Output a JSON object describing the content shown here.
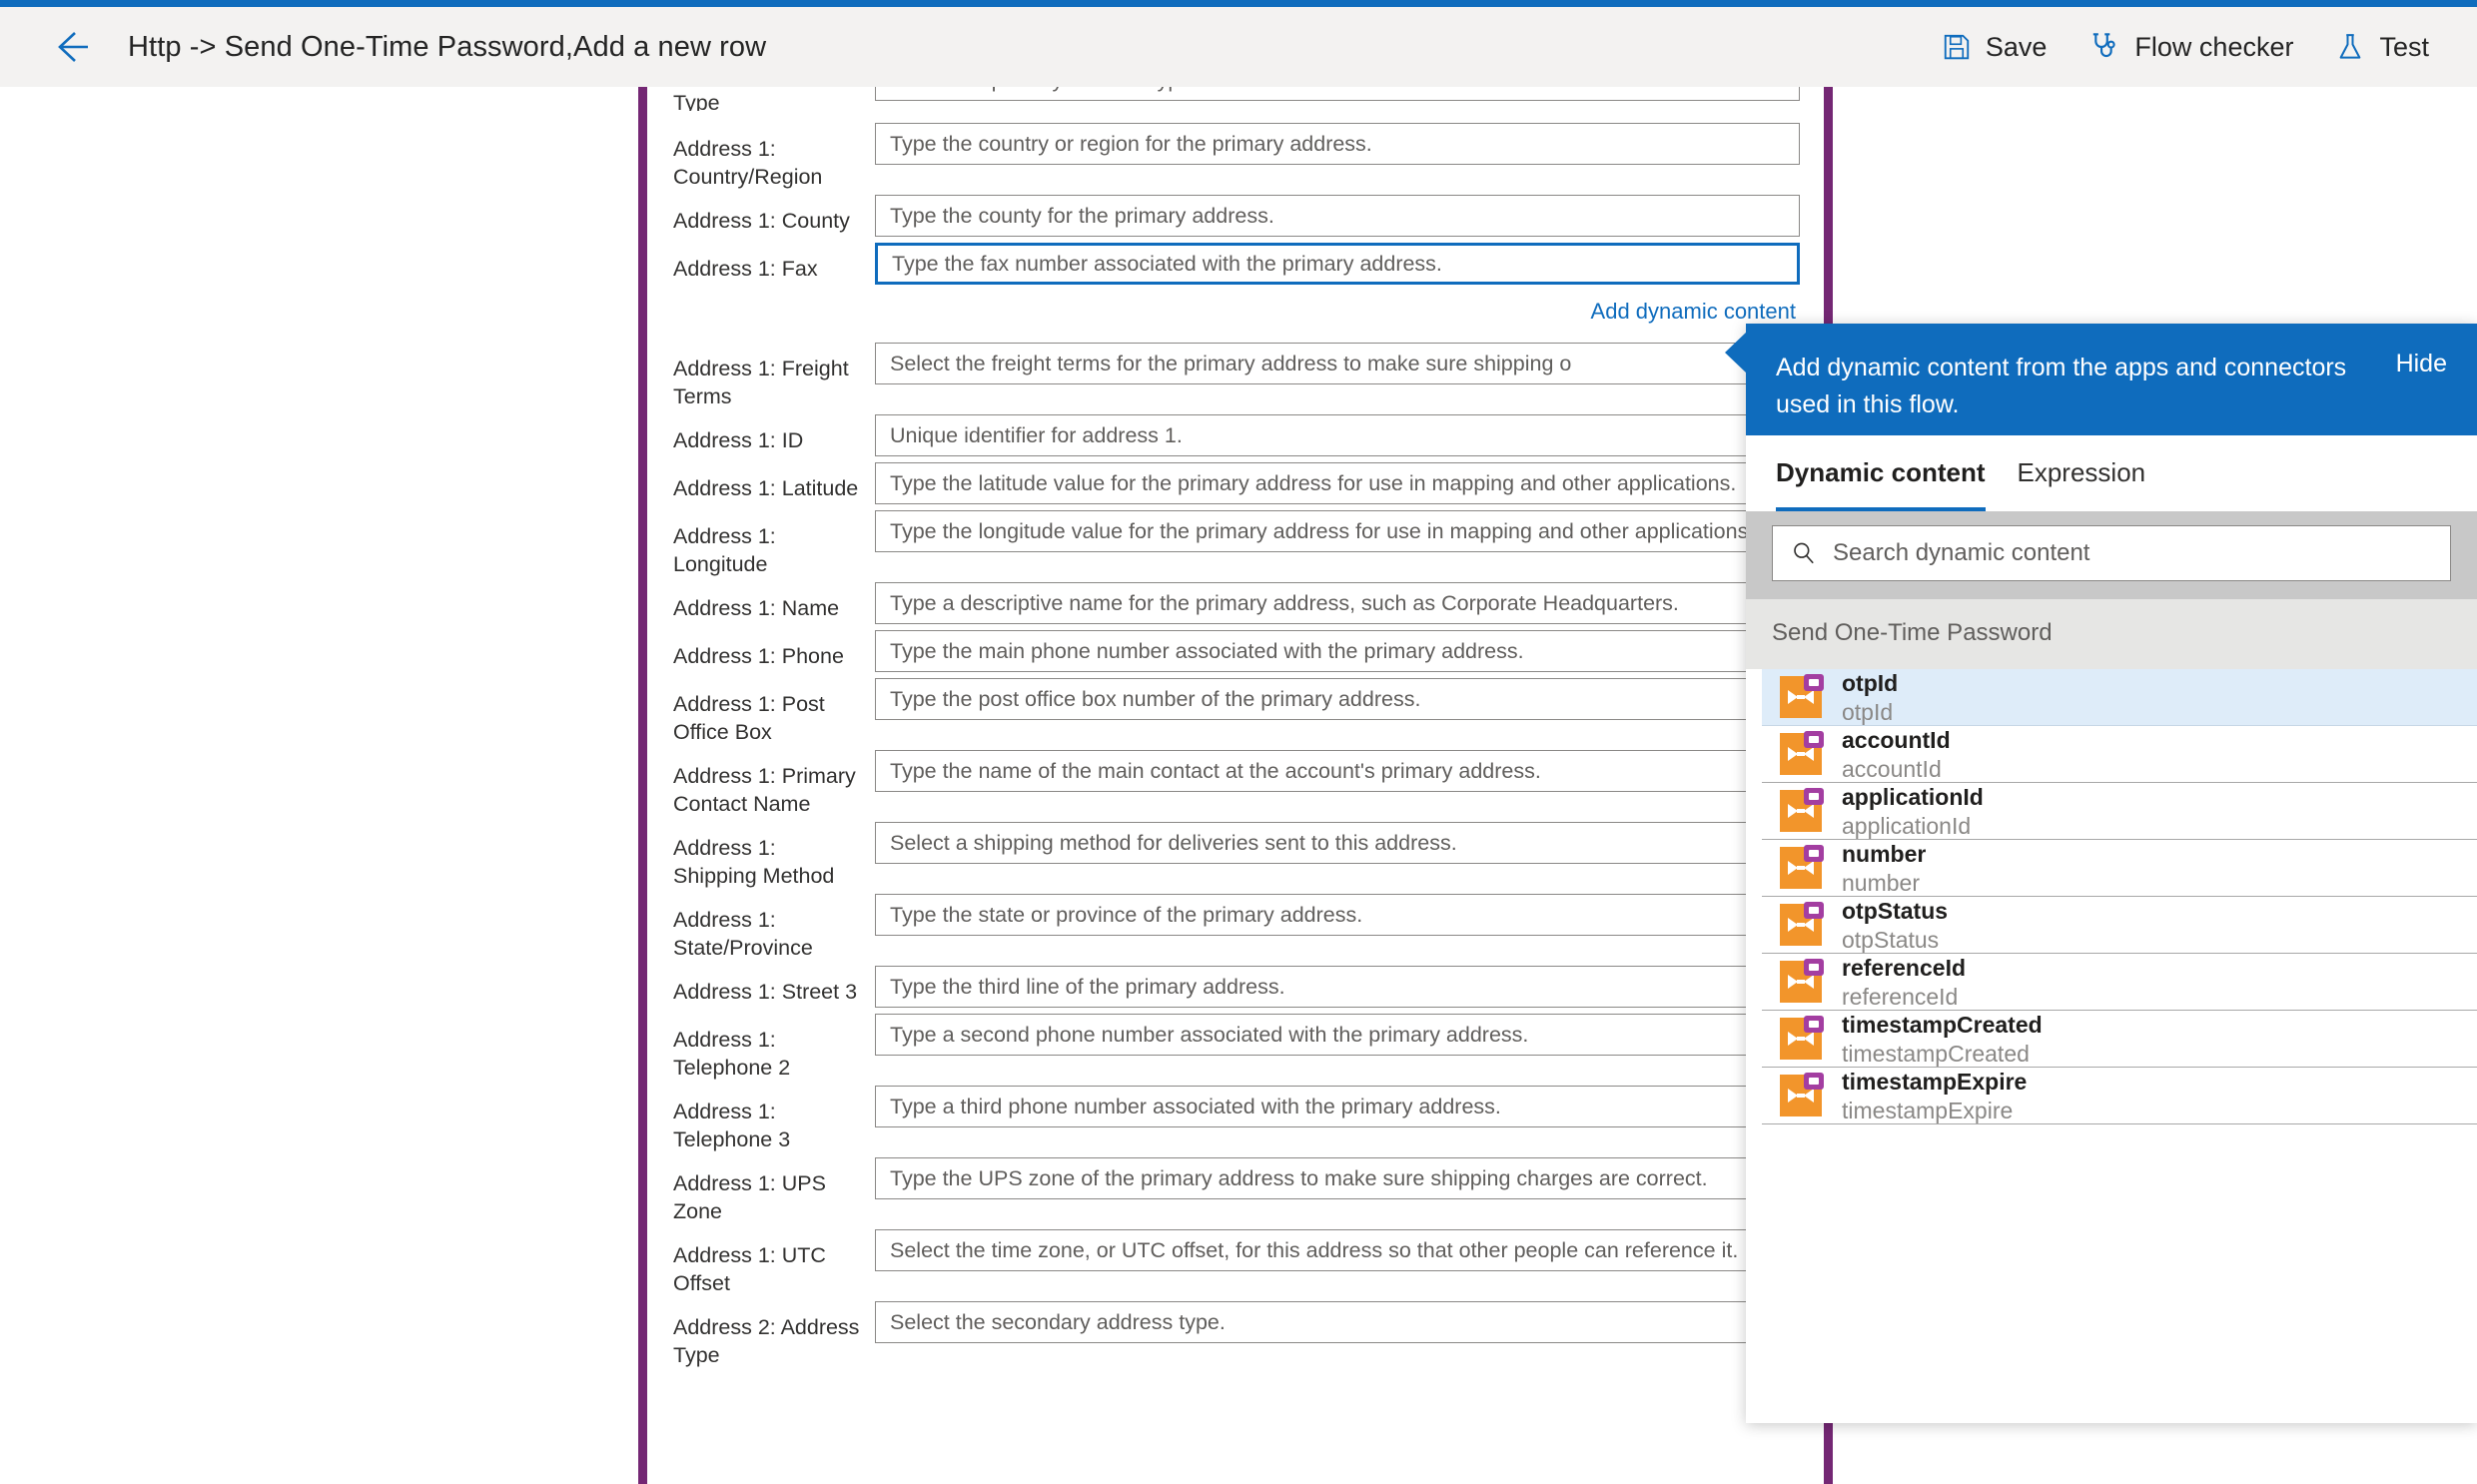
{
  "header": {
    "back_icon": "back-arrow-icon",
    "title": "Http -> Send One-Time Password,Add a new row",
    "actions": [
      {
        "label": "Save",
        "icon": "save-icon"
      },
      {
        "label": "Flow checker",
        "icon": "stethoscope-icon"
      },
      {
        "label": "Test",
        "icon": "flask-icon"
      }
    ]
  },
  "form": {
    "clipped_top_row": {
      "label": "Type",
      "placeholder": "Select the primary address type."
    },
    "fields": [
      {
        "label": "Address 1: Country/Region",
        "placeholder": "Type the country or region for the primary address.",
        "type": "text"
      },
      {
        "label": "Address 1: County",
        "placeholder": "Type the county for the primary address.",
        "type": "text"
      },
      {
        "label": "Address 1: Fax",
        "placeholder": "Type the fax number associated with the primary address.",
        "type": "text",
        "focused": true
      },
      {
        "label": "Address 1: Freight Terms",
        "placeholder": "Select the freight terms for the primary address to make sure shipping o",
        "type": "combo"
      },
      {
        "label": "Address 1: ID",
        "placeholder": "Unique identifier for address 1.",
        "type": "text"
      },
      {
        "label": "Address 1: Latitude",
        "placeholder": "Type the latitude value for the primary address for use in mapping and other applications.",
        "type": "text"
      },
      {
        "label": "Address 1: Longitude",
        "placeholder": "Type the longitude value for the primary address for use in mapping and other applications.",
        "type": "text"
      },
      {
        "label": "Address 1: Name",
        "placeholder": "Type a descriptive name for the primary address, such as Corporate Headquarters.",
        "type": "text"
      },
      {
        "label": "Address 1: Phone",
        "placeholder": "Type the main phone number associated with the primary address.",
        "type": "text"
      },
      {
        "label": "Address 1: Post Office Box",
        "placeholder": "Type the post office box number of the primary address.",
        "type": "text"
      },
      {
        "label": "Address 1: Primary Contact Name",
        "placeholder": "Type the name of the main contact at the account's primary address.",
        "type": "text"
      },
      {
        "label": "Address 1: Shipping Method",
        "placeholder": "Select a shipping method for deliveries sent to this address.",
        "type": "combo"
      },
      {
        "label": "Address 1: State/Province",
        "placeholder": "Type the state or province of the primary address.",
        "type": "text"
      },
      {
        "label": "Address 1: Street 3",
        "placeholder": "Type the third line of the primary address.",
        "type": "text"
      },
      {
        "label": "Address 1: Telephone 2",
        "placeholder": "Type a second phone number associated with the primary address.",
        "type": "text"
      },
      {
        "label": "Address 1: Telephone 3",
        "placeholder": "Type a third phone number associated with the primary address.",
        "type": "text"
      },
      {
        "label": "Address 1: UPS Zone",
        "placeholder": "Type the UPS zone of the primary address to make sure shipping charges are correct.",
        "type": "text"
      },
      {
        "label": "Address 1: UTC Offset",
        "placeholder": "Select the time zone, or UTC offset, for this address so that other people can reference it.",
        "type": "text"
      },
      {
        "label": "Address 2: Address Type",
        "placeholder": "Select the secondary address type.",
        "type": "combo"
      }
    ],
    "add_dynamic_content_link": "Add dynamic content"
  },
  "callout": {
    "text": "Add dynamic content from the apps and connectors used in this flow.",
    "hide_label": "Hide"
  },
  "dynamic_panel": {
    "tabs": [
      {
        "label": "Dynamic content",
        "active": true
      },
      {
        "label": "Expression",
        "active": false
      }
    ],
    "search": {
      "placeholder": "Search dynamic content",
      "value": "",
      "icon": "search-icon"
    },
    "group_title": "Send One-Time Password",
    "items": [
      {
        "title": "otpId",
        "subtitle": "otpId",
        "selected": true
      },
      {
        "title": "accountId",
        "subtitle": "accountId",
        "selected": false
      },
      {
        "title": "applicationId",
        "subtitle": "applicationId",
        "selected": false
      },
      {
        "title": "number",
        "subtitle": "number",
        "selected": false
      },
      {
        "title": "otpStatus",
        "subtitle": "otpStatus",
        "selected": false
      },
      {
        "title": "referenceId",
        "subtitle": "referenceId",
        "selected": false
      },
      {
        "title": "timestampCreated",
        "subtitle": "timestampCreated",
        "selected": false
      },
      {
        "title": "timestampExpire",
        "subtitle": "timestampExpire",
        "selected": false
      }
    ]
  },
  "colors": {
    "accent_blue": "#0f6cbd",
    "card_border_purple": "#742774",
    "icon_orange": "#f2952b",
    "icon_badge_purple": "#a33ea1",
    "selected_row": "#deecf9",
    "header_bg": "#f3f2f1"
  }
}
